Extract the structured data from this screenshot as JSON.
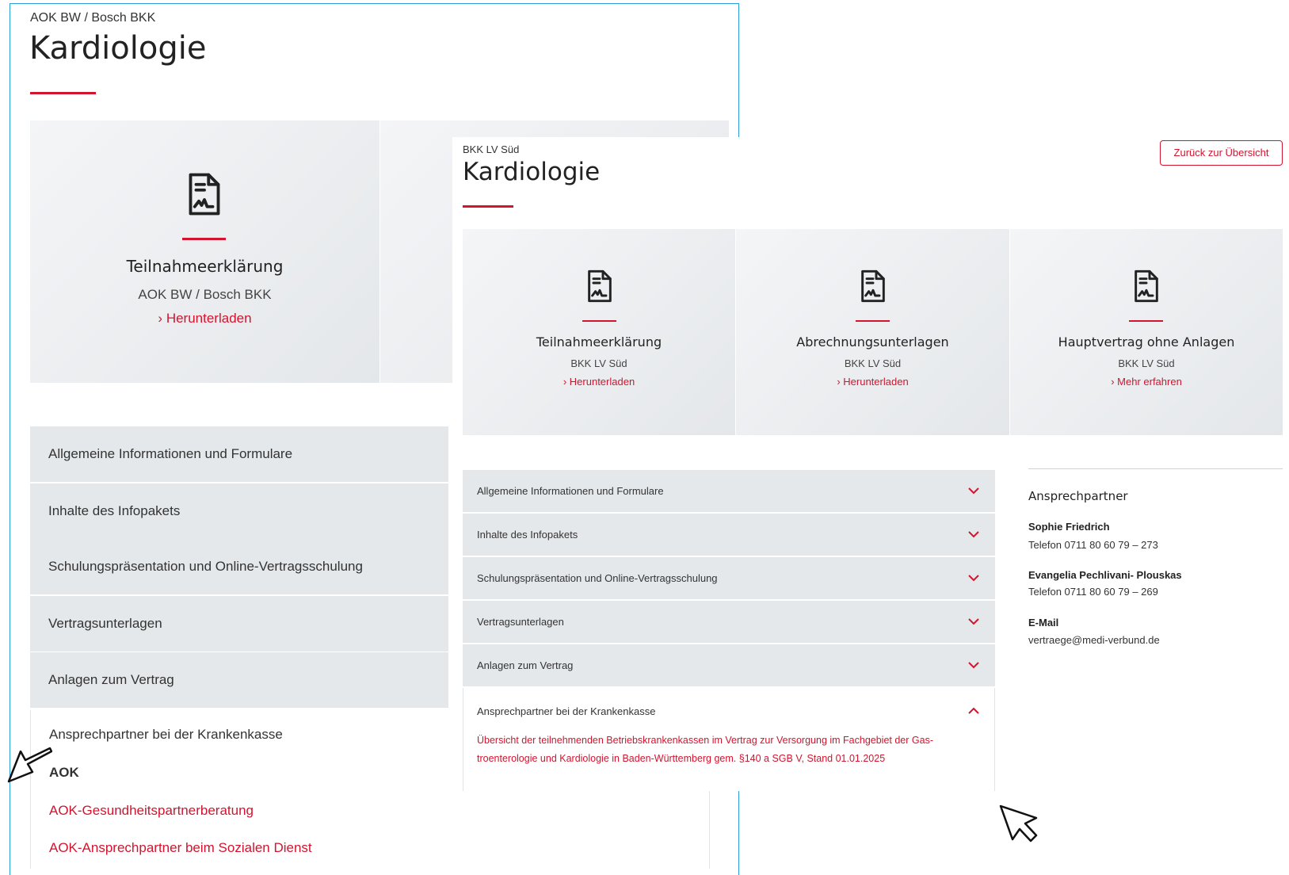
{
  "back": {
    "kasse": "AOK BW / Bosch BKK",
    "title": "Kardiologie",
    "tile": {
      "icon": "document-signature-icon",
      "title": "Teilnahmeerklärung",
      "subtitle": "AOK BW / Bosch BKK",
      "link": "Herunterladen"
    },
    "accordion": [
      "Allgemeine Informationen und Formulare",
      "Inhalte des Infopakets",
      "Schulungspräsentation und Online-Vertragsschulung",
      "Vertragsunterlagen",
      "Anlagen zum Vertrag"
    ],
    "open_item": "Ansprechpartner bei der Krankenkasse",
    "open_heading": "AOK",
    "open_links": [
      "AOK-Gesundheitspartnerberatung",
      "AOK-Ansprechpartner beim Sozialen Dienst"
    ]
  },
  "front": {
    "kasse": "BKK LV Süd",
    "title": "Kardiologie",
    "back_button": "Zurück zur Übersicht",
    "tiles": [
      {
        "icon": "document-signature-icon",
        "title": "Teilnahmeerklärung",
        "subtitle": "BKK LV Süd",
        "link": "Herunterladen"
      },
      {
        "icon": "document-signature-icon",
        "title": "Abrechnungsunterlagen",
        "subtitle": "BKK LV Süd",
        "link": "Herunterladen"
      },
      {
        "icon": "document-signature-icon",
        "title": "Hauptvertrag ohne Anlagen",
        "subtitle": "BKK LV Süd",
        "link": "Mehr erfahren"
      }
    ],
    "accordion": [
      "Allgemeine Informationen und Formulare",
      "Inhalte des Infopakets",
      "Schulungspräsentation und Online-Vertragsschulung",
      "Vertragsunterlagen",
      "Anlagen zum Vertrag"
    ],
    "open_item": "Ansprechpartner bei der Krankenkasse",
    "open_text_1": "Übersicht der teilnehmenden Betriebskrankenkassen im Vertrag zur Versorgung im Fachgebiet der Gas-",
    "open_text_2": "troenterologie und Kardiologie in Baden-Württemberg gem. §140 a SGB V, Stand 01.01.2025",
    "contact": {
      "heading": "Ansprechpartner",
      "person1_name": "Sophie Friedrich",
      "person1_phone": "Telefon 0711 80 60 79 – 273",
      "person2_name": "Evangelia Pechlivani- Plouskas",
      "person2_phone": "Telefon 0711 80 60 79 – 269",
      "email_label": "E-Mail",
      "email": "vertraege@medi-verbund.de"
    }
  },
  "colors": {
    "accent": "#d2142e",
    "frame": "#2a9fd8",
    "accordion": "#e5e8eb"
  },
  "cursors": [
    "arrow-cursor-icon",
    "arrow-cursor-icon"
  ]
}
